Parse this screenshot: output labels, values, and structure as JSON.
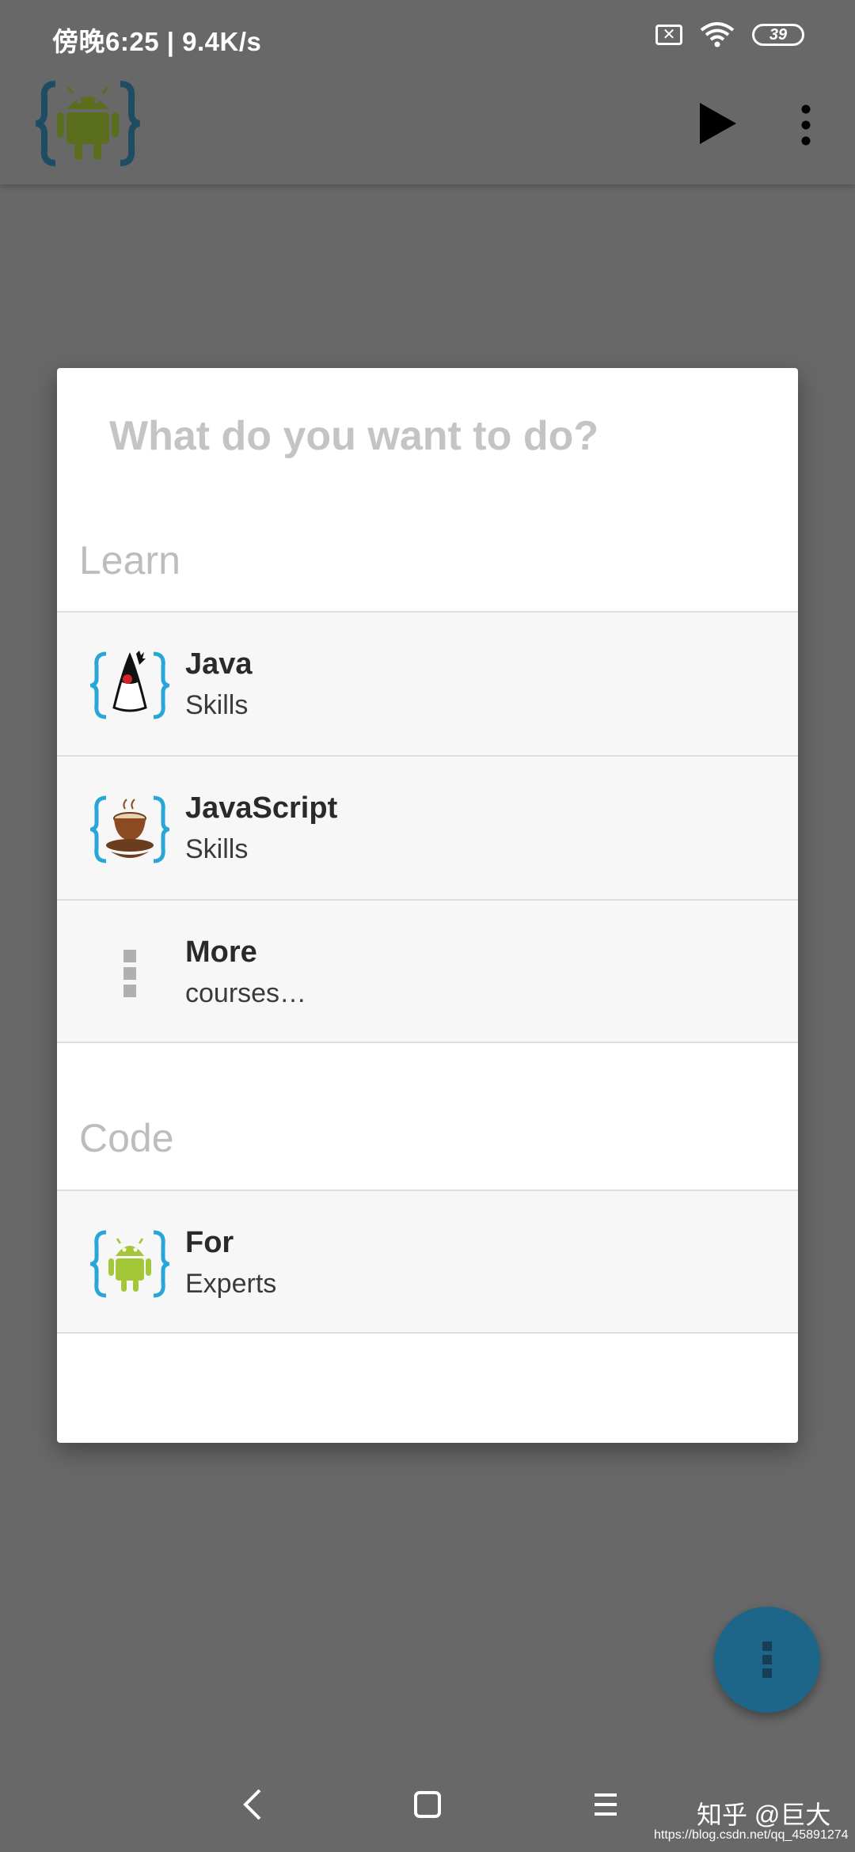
{
  "status_bar": {
    "time_speed": "傍晚6:25 | 9.4K/s",
    "battery": "39"
  },
  "app_bar": {
    "logo_icon": "android-braces-logo-icon",
    "play_icon": "play-icon",
    "menu_icon": "overflow-menu-icon"
  },
  "dialog": {
    "title": "What do you want to do?",
    "learn_header": "Learn",
    "code_header": "Code",
    "learn_items": [
      {
        "title": "Java",
        "subtitle": "Skills",
        "icon": "java-duke-icon"
      },
      {
        "title": "JavaScript",
        "subtitle": "Skills",
        "icon": "coffee-cup-icon"
      },
      {
        "title": "More",
        "subtitle": "courses…",
        "icon": "more-vertical-icon"
      }
    ],
    "code_items": [
      {
        "title": "For",
        "subtitle": "Experts",
        "icon": "android-icon"
      }
    ]
  },
  "fab": {
    "icon": "more-vertical-icon"
  },
  "nav": {
    "back": "back-icon",
    "home": "home-icon",
    "recents": "recents-icon"
  },
  "watermark": {
    "text": "知乎 @巨大",
    "url": "https://blog.csdn.net/qq_45891274"
  },
  "colors": {
    "scrim": "#686868",
    "fab": "#1e6689",
    "list_bg": "#f7f7f7",
    "header_text": "#bdbdbd"
  }
}
